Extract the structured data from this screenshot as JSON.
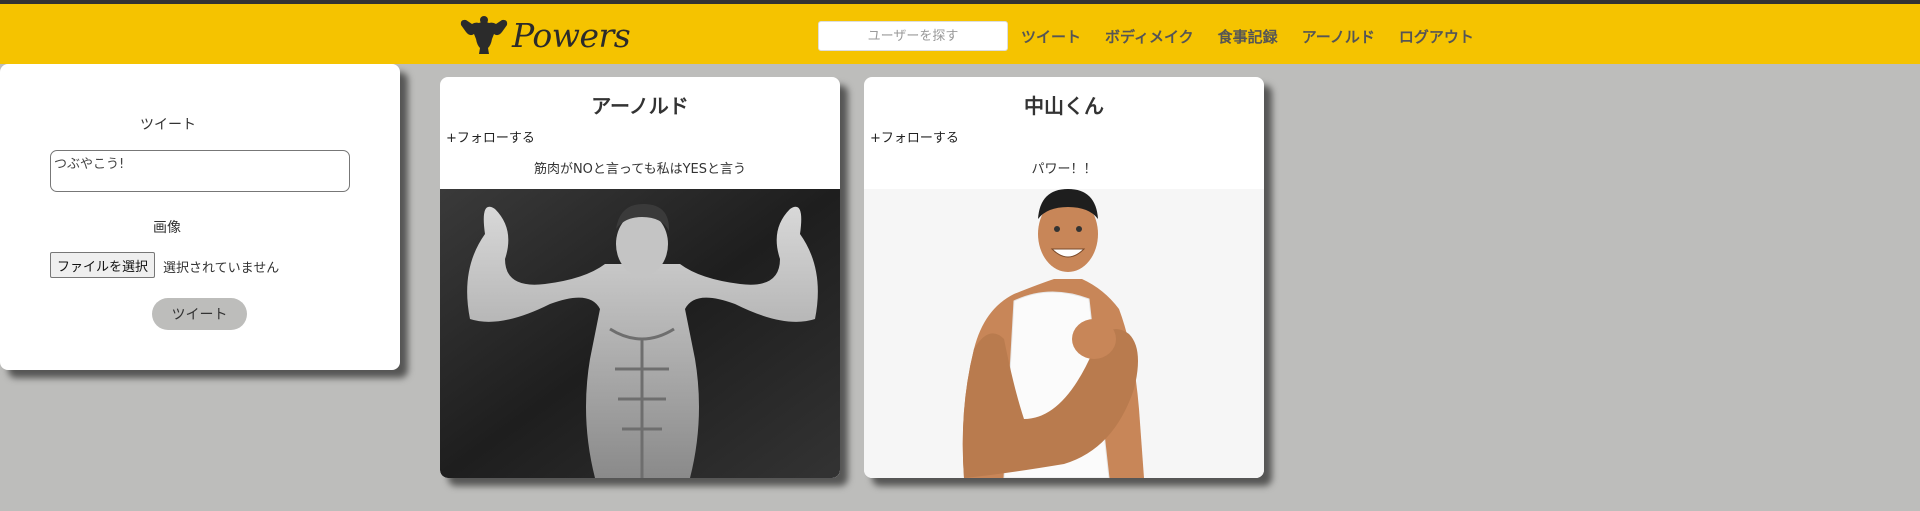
{
  "header": {
    "logo_text": "Powers",
    "search_placeholder": "ユーザーを探す",
    "nav": [
      "ツイート",
      "ボディメイク",
      "食事記録",
      "アーノルド",
      "ログアウト"
    ]
  },
  "composer": {
    "tweet_label": "ツイート",
    "textarea_placeholder": "つぶやこう!",
    "image_label": "画像",
    "file_button": "ファイルを選択",
    "file_status": "選択されていません",
    "submit_label": "ツイート"
  },
  "posts": [
    {
      "user": "アーノルド",
      "follow_label": "+フォローする",
      "text": "筋肉がNOと言っても私はYESと言う"
    },
    {
      "user": "中山くん",
      "follow_label": "+フォローする",
      "text": "パワー！！"
    }
  ],
  "colors": {
    "header": "#f5c300",
    "background": "#bdbdbb",
    "card": "#ffffff"
  }
}
